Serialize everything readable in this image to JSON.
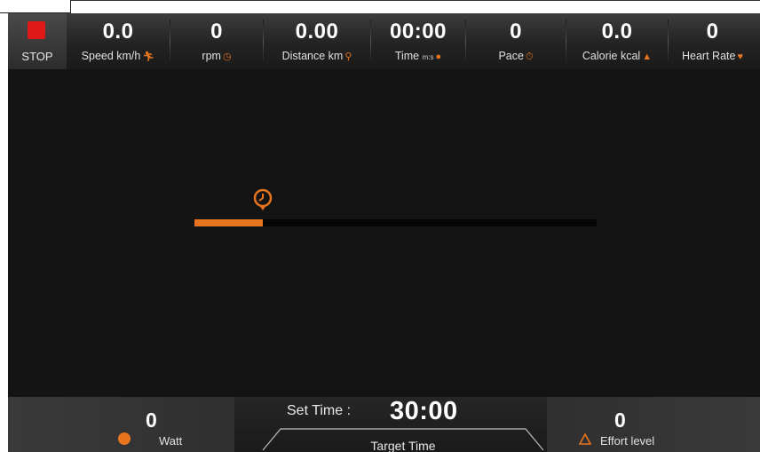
{
  "colors": {
    "accent": "#e8741e",
    "stop": "#e01818",
    "background": "#141414"
  },
  "stop": {
    "label": "STOP"
  },
  "metrics": [
    {
      "value": "0.0",
      "label": "Speed km/h",
      "icon": "runner-icon"
    },
    {
      "value": "0",
      "label": "rpm",
      "icon": "rpm-gauge-icon"
    },
    {
      "value": "0.00",
      "label": "Distance km",
      "icon": "distance-pin-icon"
    },
    {
      "value": "00:00",
      "label": "Time",
      "sublabel": "m:s",
      "icon": "time-clock-icon"
    },
    {
      "value": "0",
      "label": "Pace",
      "icon": "stopwatch-icon"
    },
    {
      "value": "0.0",
      "label": "Calorie kcal",
      "icon": "flame-icon"
    },
    {
      "value": "0",
      "label": "Heart Rate",
      "icon": "heart-icon"
    }
  ],
  "progress": {
    "fraction": 0.17,
    "marker_icon": "clock-marker-icon"
  },
  "bottom": {
    "watt": {
      "value": "0",
      "label": "Watt",
      "icon": "watt-icon"
    },
    "set_time": {
      "label": "Set Time :",
      "value": "30:00"
    },
    "target": {
      "label": "Target Time"
    },
    "effort": {
      "value": "0",
      "label": "Effort level",
      "icon": "effort-triangle-icon"
    }
  }
}
